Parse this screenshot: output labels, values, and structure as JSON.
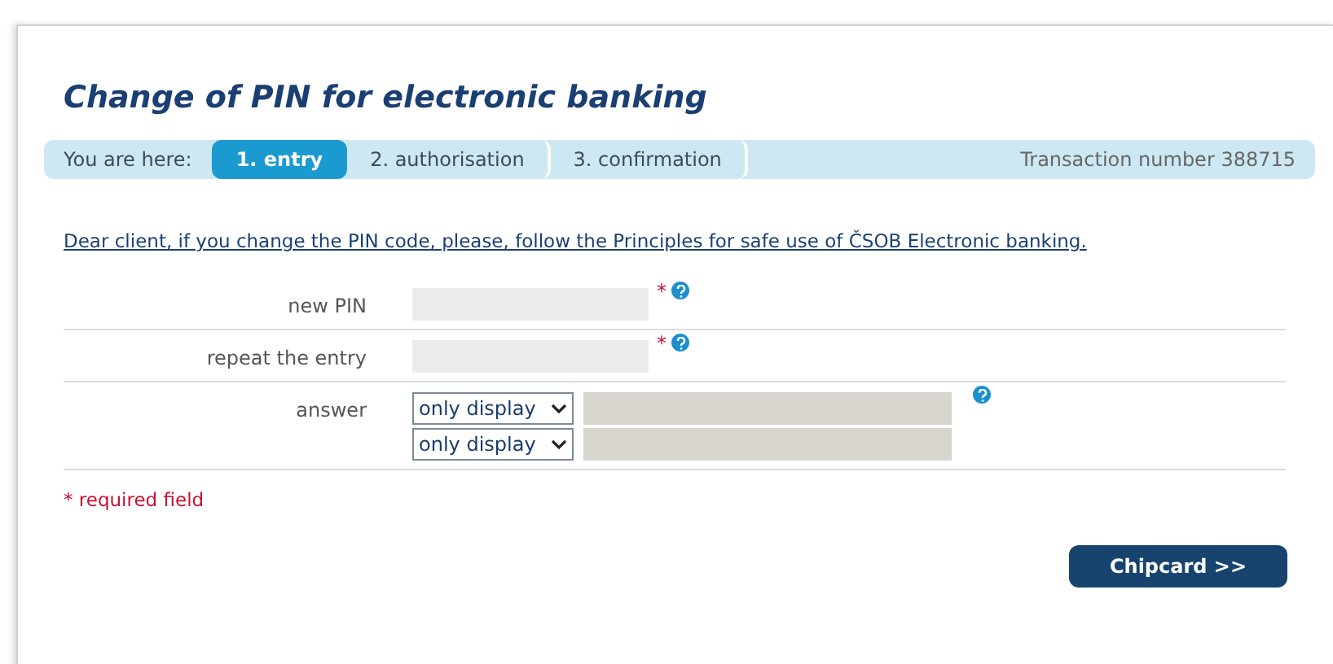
{
  "title": "Change of PIN for electronic banking",
  "breadcrumb": {
    "label": "You are here:",
    "steps": [
      {
        "label": "1. entry",
        "selected": true
      },
      {
        "label": "2. authorisation",
        "selected": false
      },
      {
        "label": "3. confirmation",
        "selected": false
      }
    ],
    "transaction": "Transaction number 388715"
  },
  "notice": "Dear client, if you change the PIN code, please, follow the Principles for safe use of ČSOB Electronic banking.",
  "rows": [
    {
      "kind": "text",
      "label": "new PIN",
      "required": true,
      "help": true
    },
    {
      "kind": "text",
      "label": "repeat the entry",
      "required": true,
      "help": true
    },
    {
      "kind": "select",
      "label": "answer",
      "help": true,
      "selects": [
        "only display",
        "only display"
      ]
    }
  ],
  "required_mark": "*",
  "required_note": "required field",
  "button": "Chipcard >>"
}
